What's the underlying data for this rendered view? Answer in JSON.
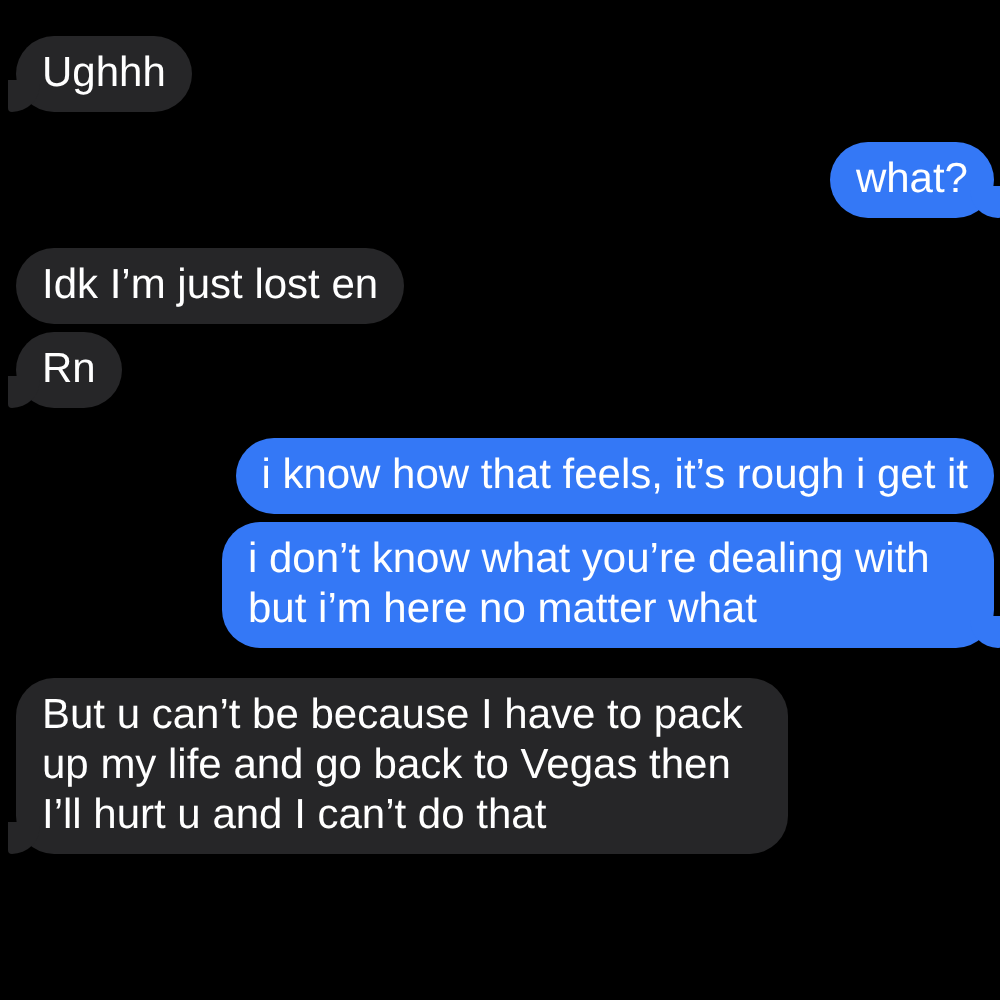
{
  "messages": [
    {
      "kind": "received",
      "text": "Ughhh",
      "tail": true
    },
    {
      "kind": "sent",
      "text": "what?",
      "tail": true
    },
    {
      "kind": "received",
      "text": "Idk I’m just lost en",
      "tail": false
    },
    {
      "kind": "received",
      "text": "Rn",
      "tail": true
    },
    {
      "kind": "sent",
      "text": "i know how that feels, it’s rough i get it",
      "tail": false
    },
    {
      "kind": "sent",
      "text": "i don’t know what you’re dealing with but i’m here no matter what",
      "tail": true
    },
    {
      "kind": "received",
      "text": "But u can’t be because I have to pack up my life and go back to Vegas then I’ll hurt u and I can’t do that",
      "tail": true
    }
  ]
}
